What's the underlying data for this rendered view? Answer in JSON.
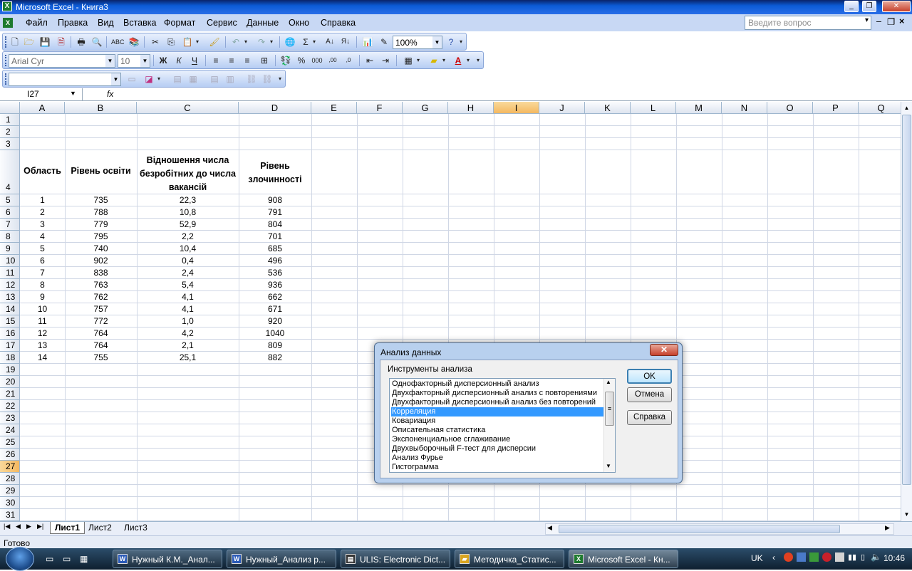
{
  "window": {
    "title": "Microsoft Excel - Книга3"
  },
  "menu": {
    "items": [
      "Файл",
      "Правка",
      "Вид",
      "Вставка",
      "Формат",
      "Сервис",
      "Данные",
      "Окно",
      "Справка"
    ],
    "ask_placeholder": "Введите вопрос"
  },
  "toolbar": {
    "zoom": "100%",
    "font_name": "Arial Cyr",
    "font_size": "10",
    "bold": "Ж",
    "italic": "К",
    "underline": "Ч"
  },
  "formula_bar": {
    "name_box": "I27",
    "fx": "fx"
  },
  "columns": [
    "A",
    "B",
    "C",
    "D",
    "E",
    "F",
    "G",
    "H",
    "I",
    "J",
    "K",
    "L",
    "M",
    "N",
    "O",
    "P",
    "Q"
  ],
  "rows": [
    "1",
    "2",
    "3",
    "4",
    "5",
    "6",
    "7",
    "8",
    "9",
    "10",
    "11",
    "12",
    "13",
    "14",
    "15",
    "16",
    "17",
    "18",
    "19",
    "20",
    "21",
    "22",
    "23",
    "24",
    "25",
    "26",
    "27",
    "28",
    "29",
    "30",
    "31"
  ],
  "table": {
    "headers": [
      "Область",
      "Рівень освіти",
      "Відношення числа безробітних до числа вакансій",
      "Рівень злочинності"
    ],
    "rows": [
      [
        "1",
        "735",
        "22,3",
        "908"
      ],
      [
        "2",
        "788",
        "10,8",
        "791"
      ],
      [
        "3",
        "779",
        "52,9",
        "804"
      ],
      [
        "4",
        "795",
        "2,2",
        "701"
      ],
      [
        "5",
        "740",
        "10,4",
        "685"
      ],
      [
        "6",
        "902",
        "0,4",
        "496"
      ],
      [
        "7",
        "838",
        "2,4",
        "536"
      ],
      [
        "8",
        "763",
        "5,4",
        "936"
      ],
      [
        "9",
        "762",
        "4,1",
        "662"
      ],
      [
        "10",
        "757",
        "4,1",
        "671"
      ],
      [
        "11",
        "772",
        "1,0",
        "920"
      ],
      [
        "12",
        "764",
        "4,2",
        "1040"
      ],
      [
        "13",
        "764",
        "2,1",
        "809"
      ],
      [
        "14",
        "755",
        "25,1",
        "882"
      ]
    ]
  },
  "sheets": [
    "Лист1",
    "Лист2",
    "Лист3"
  ],
  "status": {
    "text": "Готово"
  },
  "dialog": {
    "title": "Анализ данных",
    "group_label": "Инструменты анализа",
    "items": [
      "Однофакторный дисперсионный анализ",
      "Двухфакторный дисперсионный анализ с повторениями",
      "Двухфакторный дисперсионный анализ без повторений",
      "Корреляция",
      "Ковариация",
      "Описательная статистика",
      "Экспоненциальное сглаживание",
      "Двухвыборочный F-тест для дисперсии",
      "Анализ Фурье",
      "Гистограмма"
    ],
    "selected": "Корреляция",
    "ok": "OK",
    "cancel": "Отмена",
    "help": "Справка"
  },
  "taskbar": {
    "tasks": [
      "Нужный К.М._Анал...",
      "Нужный_Анализ р...",
      "ULIS: Electronic Dict...",
      "Методичка_Статис...",
      "Microsoft Excel - Кн..."
    ],
    "lang": "UK",
    "time": "10:46"
  }
}
